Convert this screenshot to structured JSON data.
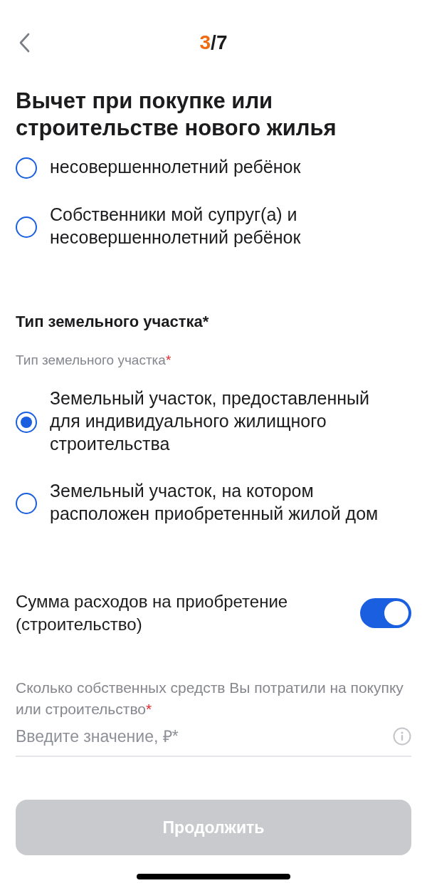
{
  "header": {
    "step_current": "3",
    "step_rest": "/7"
  },
  "title": "Вычет при покупке или строительстве нового жилья",
  "owners_options": [
    {
      "label": "несовершеннолетний ребёнок",
      "selected": false
    },
    {
      "label": "Собственники мой супруг(а) и несовершеннолетний ребёнок",
      "selected": false
    }
  ],
  "land_section": {
    "heading": "Тип земельного участка*",
    "label": "Тип земельного участка",
    "required_mark": "*",
    "options": [
      {
        "label": "Земельный участок, предоставленный для индивидуального жилищного строительства",
        "selected": true
      },
      {
        "label": "Земельный участок, на котором расположен приобретенный жилой дом",
        "selected": false
      }
    ]
  },
  "expenses_toggle": {
    "label": "Сумма расходов на приобретение (строительство)",
    "on": true
  },
  "amount_field": {
    "label": "Сколько собственных средств Вы потратили на покупку или строительство",
    "required_mark": "*",
    "placeholder": "Введите значение, ₽*"
  },
  "continue_button": {
    "label": "Продолжить",
    "disabled": true
  }
}
